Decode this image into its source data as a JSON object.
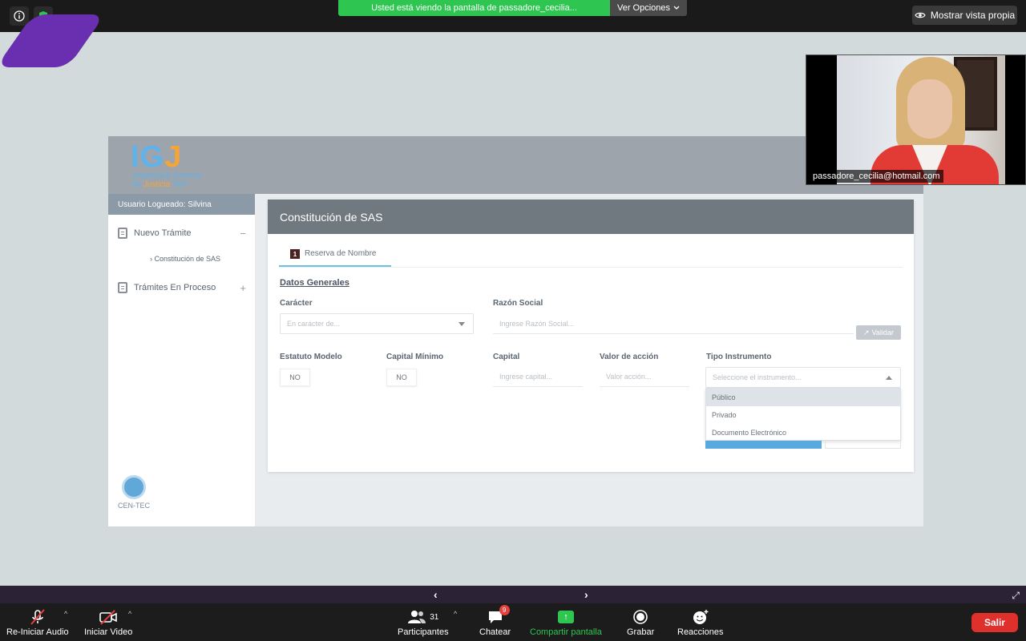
{
  "topbar": {
    "share_banner": "Usted está viendo la pantalla de passadore_cecilia...",
    "view_options": "Ver Opciones",
    "self_view": "Mostrar vista propia"
  },
  "app": {
    "logo_title_a": "IG",
    "logo_title_b": "J",
    "logo_line1": "Inspección General",
    "logo_line2a": "de ",
    "logo_line2b": "Justicia",
    "logo_line2c": " TDF",
    "user_bar": "Usuario Logueado: Silvina",
    "sidebar": {
      "nuevo_tramite": "Nuevo Trámite",
      "nuevo_tramite_toggle": "−",
      "constitucion_sas": "Constitución de SAS",
      "tramites_en_proceso": "Trámites En Proceso",
      "tramites_toggle": "+",
      "centec": "CEN-TEC"
    },
    "card": {
      "title": "Constitución de SAS",
      "tab_number": "1",
      "tab_label": "Reserva de Nombre",
      "section_title": "Datos Generales",
      "caracter_label": "Carácter",
      "caracter_placeholder": "En carácter de...",
      "razon_social_label": "Razón Social",
      "razon_social_placeholder": "Ingrese Razón Social...",
      "validar": "Validar",
      "estatuto_label": "Estatuto Modelo",
      "estatuto_value": "NO",
      "capital_minimo_label": "Capital Mínimo",
      "capital_minimo_value": "NO",
      "capital_label": "Capital",
      "capital_placeholder": "Ingrese capital...",
      "valor_accion_label": "Valor de acción",
      "valor_accion_placeholder": "Valor acción...",
      "tipo_instrumento_label": "Tipo Instrumento",
      "tipo_instrumento_placeholder": "Seleccione el instrumento...",
      "options": [
        "Público",
        "Privado",
        "Documento Electrónico"
      ]
    }
  },
  "participant": {
    "name": "passadore_cecilia@hotmail.com"
  },
  "toolbar": {
    "audio": "Re-Iniciar Audio",
    "video": "Iniciar Video",
    "participants": "Participantes",
    "participants_count": "31",
    "chat": "Chatear",
    "chat_badge": "9",
    "share": "Compartir pantalla",
    "record": "Grabar",
    "reactions": "Reacciones",
    "leave": "Salir"
  },
  "colors": {
    "share_green": "#2ec651",
    "leave_red": "#e0302b",
    "igj_blue": "#5fb3ea",
    "igj_orange": "#f3a53c"
  }
}
